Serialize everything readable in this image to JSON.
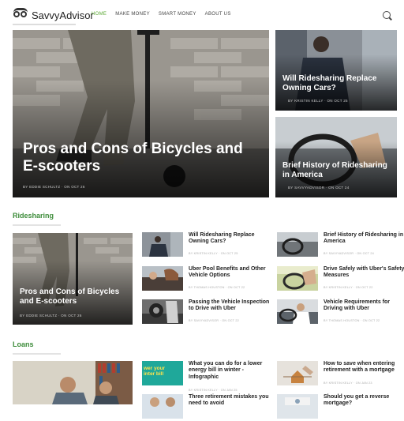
{
  "site": {
    "name": "SavvyAdvisor"
  },
  "nav": {
    "items": [
      "HOME",
      "MAKE MONEY",
      "SMART MONEY",
      "ABOUT US"
    ]
  },
  "hero": {
    "main": {
      "title": "Pros and Cons of Bicycles and E-scooters",
      "meta": "BY EDDIE SCHULTZ · ON OCT 26"
    },
    "side1": {
      "title": "Will Ridesharing Replace Owning Cars?",
      "meta": "BY KRISTIN KELLY · ON OCT 25"
    },
    "side2": {
      "title": "Brief History of Ridesharing in America",
      "meta": "BY SAVVYADVISOR · ON OCT 24"
    }
  },
  "ridesharing": {
    "title": "Ridesharing",
    "featured": {
      "title": "Pros and Cons of Bicycles and E-scooters",
      "meta": "BY EDDIE SCHULTZ · ON OCT 26"
    },
    "items": [
      {
        "title": "Will Ridesharing Replace Owning Cars?",
        "meta": "BY KRISTIN KELLY · ON OCT 25"
      },
      {
        "title": "Brief History of Ridesharing in America",
        "meta": "BY SAVVYADVISOR · ON OCT 24"
      },
      {
        "title": "Uber Pool Benefits and Other Vehicle Options",
        "meta": "BY THOMAS HOUSTON · ON OCT 22"
      },
      {
        "title": "Drive Safely with Uber's Safety Measures",
        "meta": "BY KRISTIN KELLY · ON OCT 22"
      },
      {
        "title": "Passing the Vehicle Inspection to Drive with Uber",
        "meta": "BY SAVVYADVISOR · ON OCT 22"
      },
      {
        "title": "Vehicle Requirements for Driving with Uber",
        "meta": "BY THOMAS HOUSTON · ON OCT 22"
      }
    ]
  },
  "loans": {
    "title": "Loans",
    "items": [
      {
        "title": "What you can do for a lower energy bill in winter - Infographic",
        "meta": "BY KRISTIN KELLY · ON JAN 25",
        "thumb_text": "wer your inter bill"
      },
      {
        "title": "How to save when entering retirement with a mortgage",
        "meta": "BY KRISTIN KELLY · ON JAN 23"
      },
      {
        "title": "Three retirement mistakes you need to avoid",
        "meta": ""
      },
      {
        "title": "Should you get a reverse mortgage?",
        "meta": ""
      }
    ]
  },
  "colors": {
    "accent": "#5aa832",
    "section": "#3d8c3a"
  }
}
